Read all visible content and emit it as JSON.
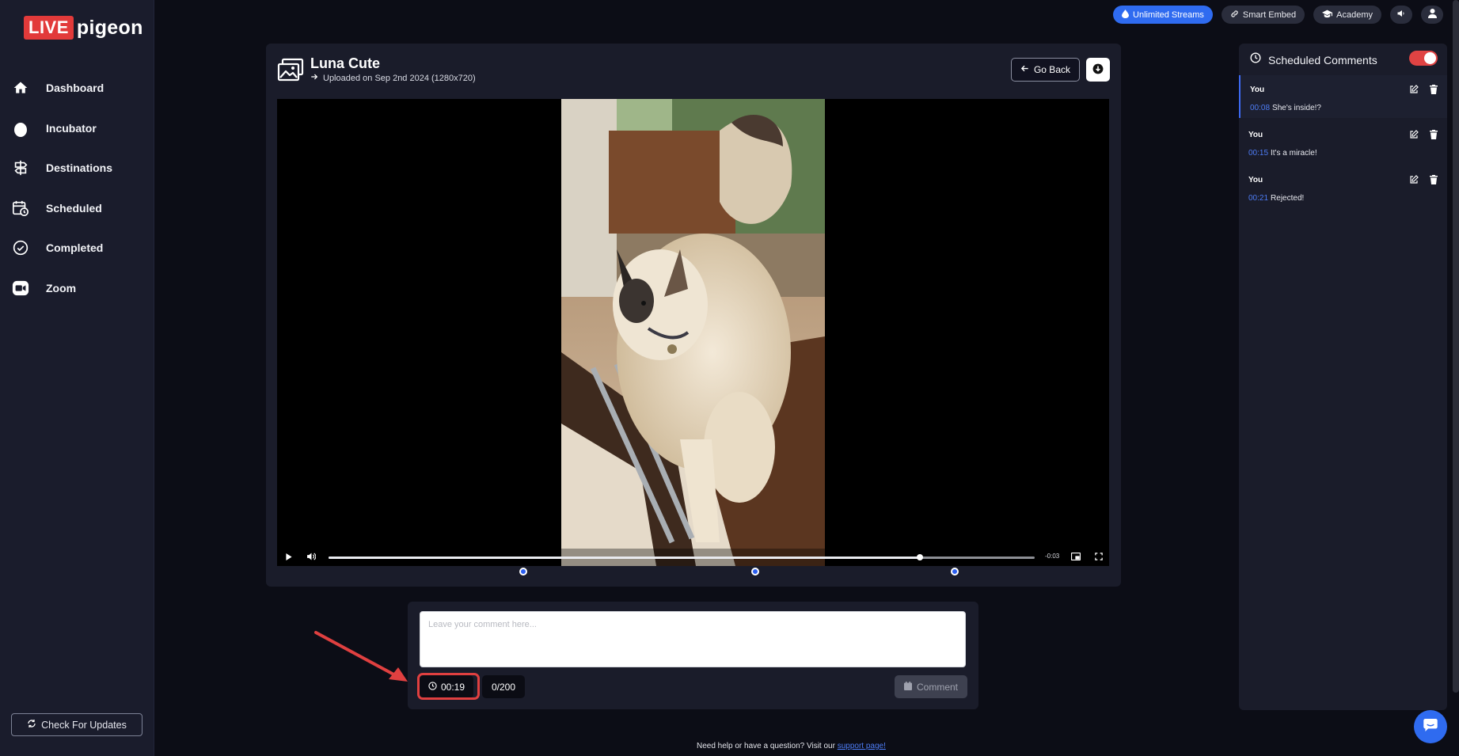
{
  "brand": {
    "live": "LIVE",
    "pigeon": "pigeon"
  },
  "sidebar": {
    "items": [
      {
        "label": "Dashboard",
        "icon": "home-icon"
      },
      {
        "label": "Incubator",
        "icon": "egg-icon"
      },
      {
        "label": "Destinations",
        "icon": "signpost-icon"
      },
      {
        "label": "Scheduled",
        "icon": "calendar-clock-icon"
      },
      {
        "label": "Completed",
        "icon": "check-circle-icon"
      },
      {
        "label": "Zoom",
        "icon": "video-camera-icon"
      }
    ],
    "check_updates": "Check For Updates"
  },
  "topbar": {
    "unlimited_streams": "Unlimited Streams",
    "smart_embed": "Smart Embed",
    "academy": "Academy"
  },
  "video": {
    "title": "Luna Cute",
    "uploaded": "Uploaded on Sep 2nd 2024 (1280x720)",
    "go_back": "Go Back",
    "time_left": "-0:03",
    "progress": 0.837,
    "markers": [
      0.296,
      0.575,
      0.814
    ]
  },
  "composer": {
    "placeholder": "Leave your comment here...",
    "timestamp": "00:19",
    "char_count": "0/200",
    "submit": "Comment"
  },
  "scheduled": {
    "title": "Scheduled Comments",
    "enabled": true,
    "items": [
      {
        "author": "You",
        "time": "00:08",
        "text": "She's inside!?"
      },
      {
        "author": "You",
        "time": "00:15",
        "text": "It's a miracle!"
      },
      {
        "author": "You",
        "time": "00:21",
        "text": "Rejected!"
      }
    ]
  },
  "footer": {
    "text": "Need help or have a question? Visit our ",
    "link": "support page!"
  },
  "colors": {
    "accent": "#2f6bf0",
    "danger": "#e04343",
    "bg": "#0c0d16",
    "card": "#1a1c2a"
  }
}
